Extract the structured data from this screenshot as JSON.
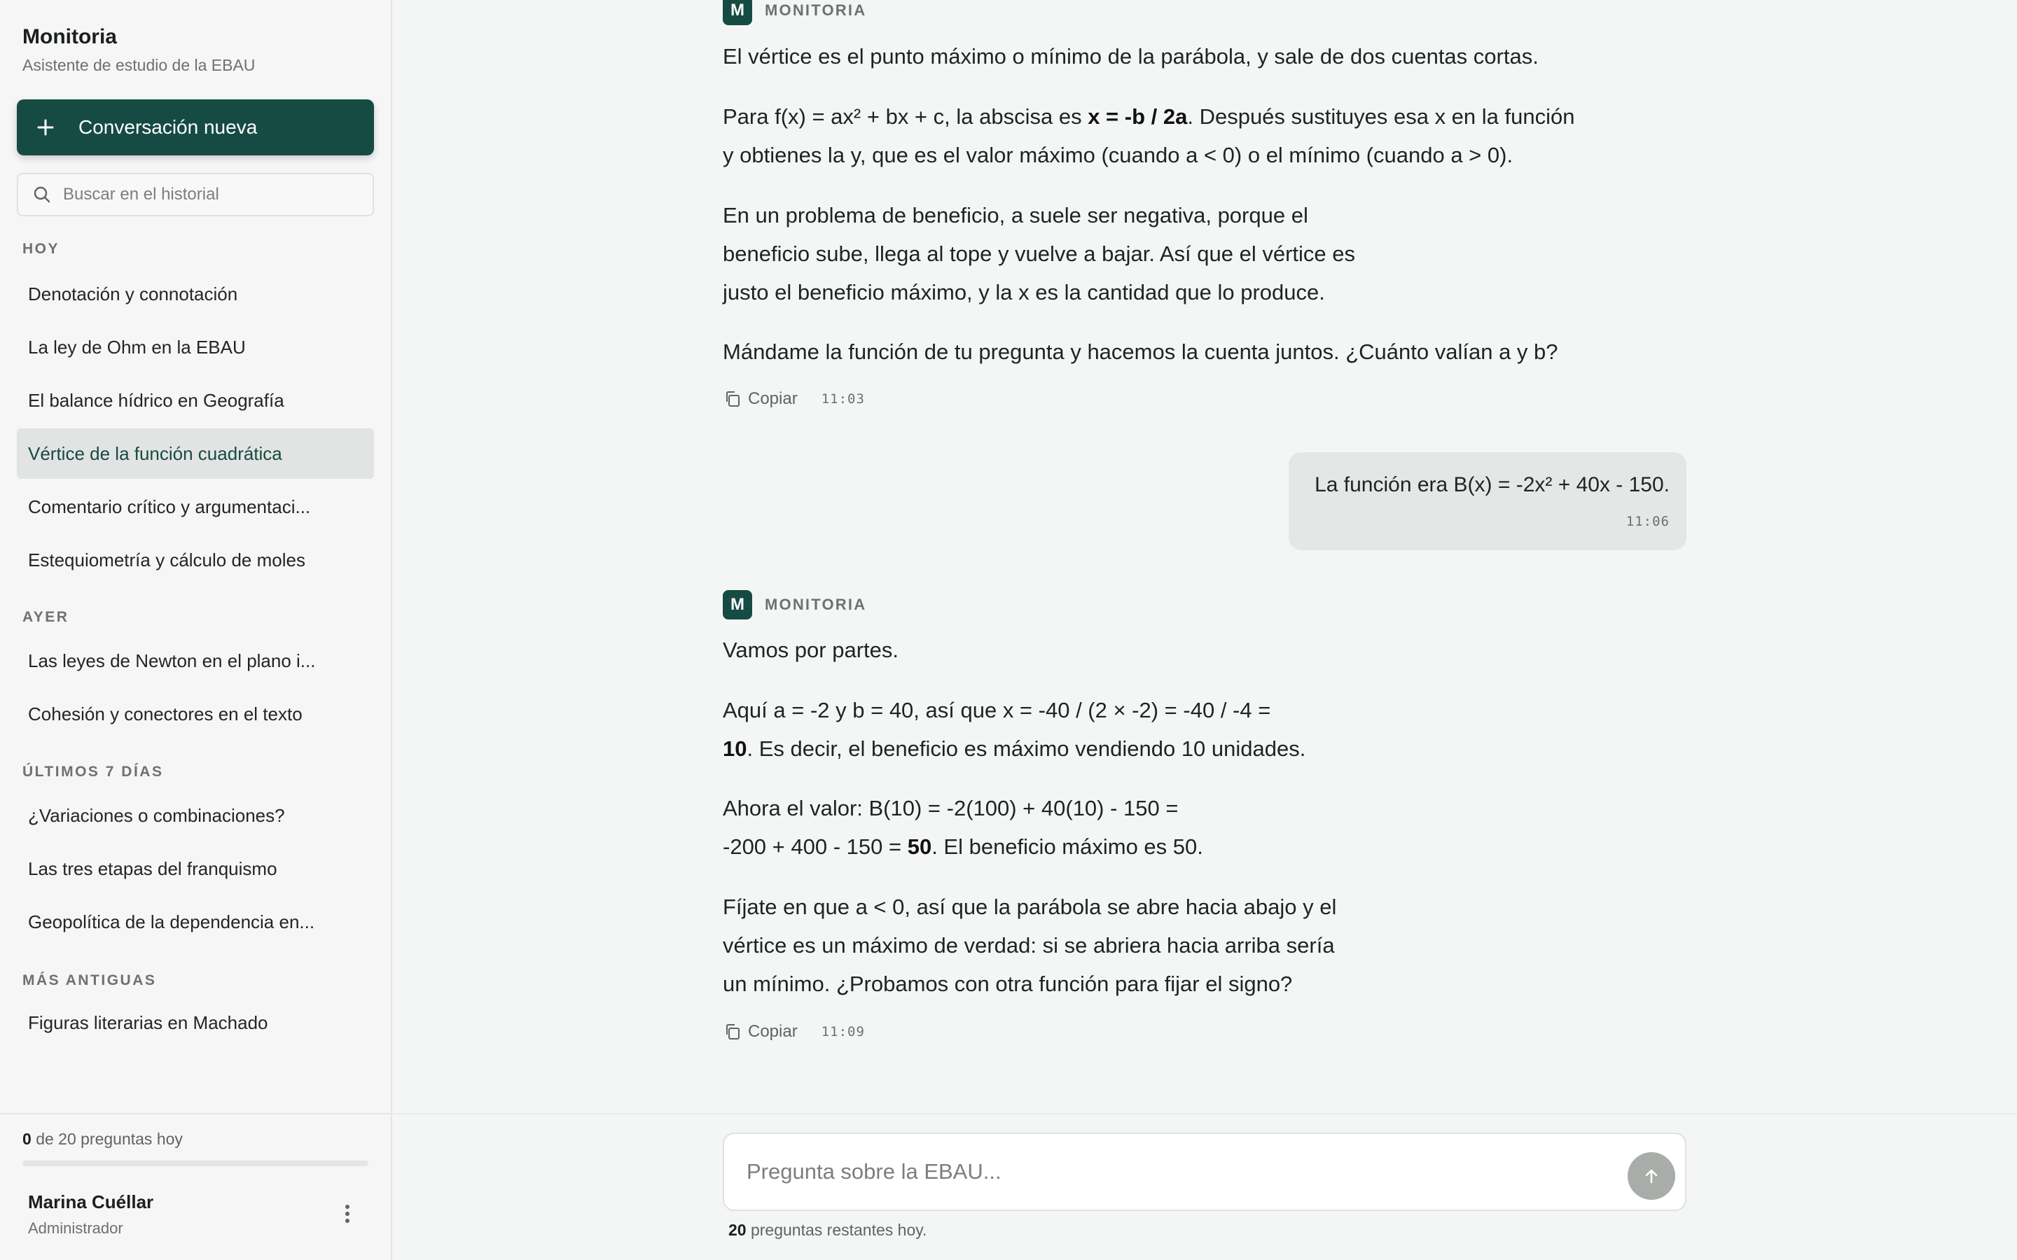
{
  "app": {
    "title": "Monitoria",
    "subtitle": "Asistente de estudio de la EBAU",
    "accent_color": "#164b43"
  },
  "sidebar": {
    "new_chat_label": "Conversación nueva",
    "search_placeholder": "Buscar en el historial",
    "sections": [
      {
        "title": "HOY",
        "items": [
          "Denotación y connotación",
          "La ley de Ohm en la EBAU",
          "El balance hídrico en Geografía",
          "Vértice de la función cuadrática",
          "Comentario crítico y argumentaci...",
          "Estequiometría y cálculo de moles"
        ]
      },
      {
        "title": "AYER",
        "items": [
          "Las leyes de Newton en el plano i...",
          "Cohesión y conectores en el texto"
        ]
      },
      {
        "title": "ÚLTIMOS 7 DÍAS",
        "items": [
          "¿Variaciones o combinaciones?",
          "Las tres etapas del franquismo",
          "Geopolítica de la dependencia en..."
        ]
      },
      {
        "title": "MÁS ANTIGUAS",
        "items": [
          "Figuras literarias en Machado"
        ]
      }
    ],
    "active_item": "Vértice de la función cuadrática",
    "quota": {
      "used": "0",
      "text": "de 20 preguntas hoy",
      "fraction": 0
    },
    "user": {
      "name": "Marina Cuéllar",
      "role": "Administrador"
    }
  },
  "chat": {
    "assistant_label": "MONITORIA",
    "avatar_letter": "M",
    "copy_label": "Copiar",
    "messages": [
      {
        "role": "assistant",
        "time": "11:03",
        "paragraphs": [
          {
            "lines": [
              "El vértice es el punto máximo o mínimo de la parábola, y sale de dos cuentas cortas."
            ]
          },
          {
            "lines": [
              "Para f(x) = ax² + bx + c, la abscisa es ",
              "x = -b / 2a",
              ". Después sustituyes esa x en la función",
              "y obtienes la y, que es el valor máximo (cuando a < 0) o el mínimo (cuando a > 0)."
            ]
          },
          {
            "lines": [
              "En un problema de beneficio, a suele ser negativa, porque el",
              "beneficio sube, llega al tope y vuelve a bajar. Así que el vértice es",
              "justo el beneficio máximo, y la x es la cantidad que lo produce."
            ]
          },
          {
            "lines": [
              "Mándame la función de tu pregunta y hacemos la cuenta juntos. ¿Cuánto valían a y b?"
            ]
          }
        ]
      },
      {
        "role": "user",
        "text": "La función era B(x) = -2x² + 40x - 150.",
        "time": "11:06"
      },
      {
        "role": "assistant",
        "time": "11:09",
        "paragraphs": [
          {
            "lines": [
              "Vamos por partes."
            ]
          },
          {
            "lines": [
              "Aquí a = -2 y b = 40, así que x = -40 / (2 × -2) = -40 / -4 =",
              "10",
              ". Es decir, el beneficio es máximo vendiendo 10 unidades."
            ]
          },
          {
            "lines": [
              "Ahora el valor: B(10) = -2(100) + 40(10) - 150 =",
              "-200 + 400 - 150 = ",
              "50",
              ". El beneficio máximo es 50."
            ]
          },
          {
            "lines": [
              "Fíjate en que a < 0, así que la parábola se abre hacia abajo y el",
              "vértice es un máximo de verdad: si se abriera hacia arriba sería",
              "un mínimo. ¿Probamos con otra función para fijar el signo?"
            ]
          }
        ]
      }
    ]
  },
  "composer": {
    "placeholder": "Pregunta sobre la EBAU...",
    "remaining_count": "20",
    "remaining_text": "preguntas restantes hoy."
  }
}
